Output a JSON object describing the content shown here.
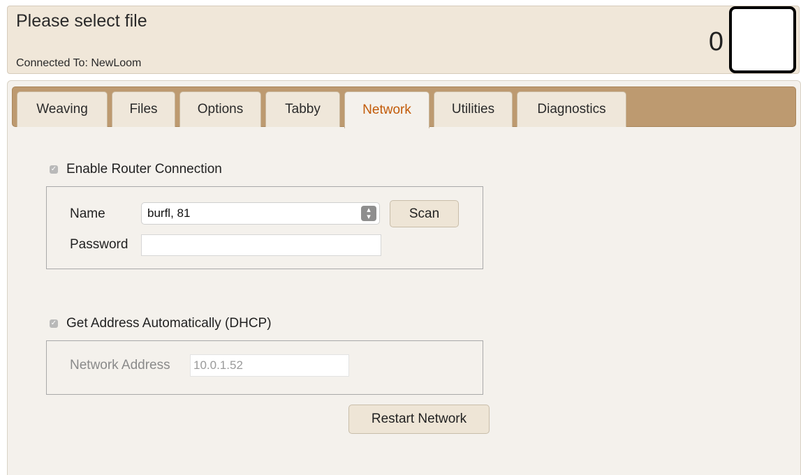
{
  "header": {
    "status": "Please select file",
    "connected": "Connected To: NewLoom",
    "pick_count": "0"
  },
  "tabs": [
    {
      "label": "Weaving"
    },
    {
      "label": "Files"
    },
    {
      "label": "Options"
    },
    {
      "label": "Tabby"
    },
    {
      "label": "Network",
      "active": true
    },
    {
      "label": "Utilities"
    },
    {
      "label": "Diagnostics"
    }
  ],
  "router": {
    "enable_label": "Enable Router Connection",
    "enabled": true,
    "name_label": "Name",
    "name_value": "burfl, 81",
    "scan_label": "Scan",
    "password_label": "Password",
    "password_value": ""
  },
  "address": {
    "dhcp_label": "Get Address Automatically (DHCP)",
    "dhcp_enabled": true,
    "network_address_label": "Network Address",
    "network_address_value": "10.0.1.52"
  },
  "restart_label": "Restart Network",
  "colors": {
    "tab_bar": "#bd9a70",
    "active_tab_text": "#c25b09",
    "header_bg": "#f0e7d9"
  }
}
